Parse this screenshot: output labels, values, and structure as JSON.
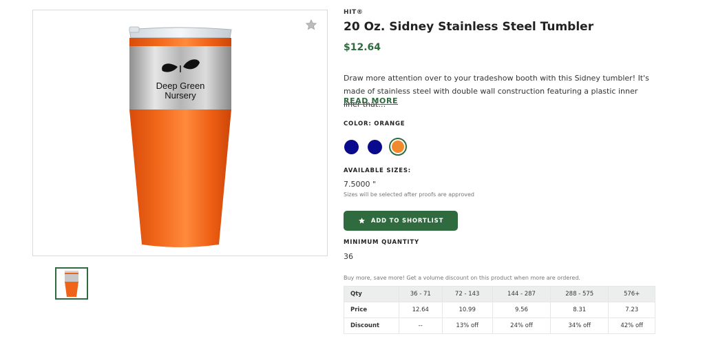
{
  "product": {
    "brand": "HIT®",
    "title": "20 Oz. Sidney Stainless Steel Tumbler",
    "price": "$12.64",
    "description": "Draw more attention over to your tradeshow booth with this Sidney tumbler! It's made of stainless steel with double wall construction featuring a plastic inner liner that…",
    "read_more": "READ MORE",
    "imprint_text_line1": "Deep Green",
    "imprint_text_line2": "Nursery"
  },
  "color": {
    "label": "COLOR: ORANGE",
    "swatches": [
      {
        "name": "Blue",
        "hex": "#0a0a8f"
      },
      {
        "name": "Navy",
        "hex": "#0a0a8f"
      },
      {
        "name": "Orange",
        "hex": "#f08a2c",
        "selected": true
      }
    ]
  },
  "sizes": {
    "label": "AVAILABLE SIZES:",
    "value": "7.5000 \"",
    "note": "Sizes will be selected after proofs are approved"
  },
  "actions": {
    "shortlist_label": "ADD TO SHORTLIST"
  },
  "min_quantity": {
    "label": "MINIMUM QUANTITY",
    "value": "36"
  },
  "pricing": {
    "note": "Buy more, save more! Get a volume discount on this product when more are ordered.",
    "header": [
      "Qty",
      "36 - 71",
      "72 - 143",
      "144 - 287",
      "288 - 575",
      "576+"
    ],
    "rows": [
      [
        "Price",
        "12.64",
        "10.99",
        "9.56",
        "8.31",
        "7.23"
      ],
      [
        "Discount",
        "--",
        "13% off",
        "24% off",
        "34% off",
        "42% off"
      ]
    ]
  },
  "colors": {
    "accent": "#2f6b3f",
    "tumbler_orange": "#f0641a",
    "steel": "#c8c8c8"
  }
}
